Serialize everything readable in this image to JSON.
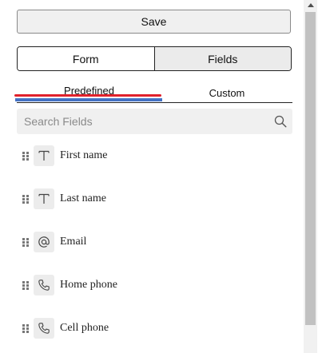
{
  "toolbar": {
    "save_label": "Save"
  },
  "mode_switch": {
    "items": [
      {
        "label": "Form"
      },
      {
        "label": "Fields",
        "selected": true
      }
    ]
  },
  "tabs": [
    {
      "label": "Predefined",
      "active": true
    },
    {
      "label": "Custom"
    }
  ],
  "search": {
    "placeholder": "Search Fields",
    "value": ""
  },
  "fields": [
    {
      "label": "First name",
      "icon": "text-icon"
    },
    {
      "label": "Last name",
      "icon": "text-icon"
    },
    {
      "label": "Email",
      "icon": "at-icon"
    },
    {
      "label": "Home phone",
      "icon": "phone-icon"
    },
    {
      "label": "Cell phone",
      "icon": "phone-icon"
    }
  ],
  "colors": {
    "tab_underline_blue": "#4472c4",
    "tab_underline_red": "#e0212b",
    "selected_segment": "#ebebeb"
  }
}
